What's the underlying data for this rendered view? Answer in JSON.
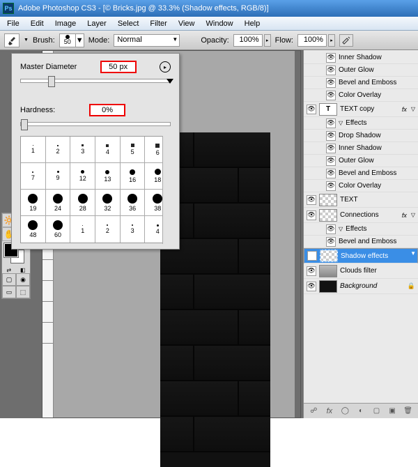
{
  "title": "Adobe Photoshop CS3 - [© Bricks.jpg @ 33.3% (Shadow effects, RGB/8)]",
  "menu": [
    "File",
    "Edit",
    "Image",
    "Layer",
    "Select",
    "Filter",
    "View",
    "Window",
    "Help"
  ],
  "optbar": {
    "brush_label": "Brush:",
    "brush_size": "50",
    "mode_label": "Mode:",
    "mode_value": "Normal",
    "opacity_label": "Opacity:",
    "opacity_value": "100%",
    "flow_label": "Flow:",
    "flow_value": "100%"
  },
  "brush_popup": {
    "diameter_label": "Master Diameter",
    "diameter_value": "50 px",
    "hardness_label": "Hardness:",
    "hardness_value": "0%",
    "presets": [
      [
        "1",
        "2",
        "3",
        "4",
        "5",
        "6"
      ],
      [
        "7",
        "9",
        "12",
        "13",
        "16",
        "18"
      ],
      [
        "19",
        "24",
        "28",
        "32",
        "36",
        "38"
      ],
      [
        "48",
        "60",
        "1",
        "2",
        "3",
        "4"
      ]
    ],
    "sizes": [
      [
        1,
        2,
        3,
        4,
        5,
        6
      ],
      [
        2,
        3,
        5,
        6,
        8,
        9
      ],
      [
        14,
        14,
        14,
        14,
        14,
        14
      ],
      [
        14,
        14,
        1,
        2,
        2,
        3
      ]
    ]
  },
  "layers": {
    "effects_label": "Effects",
    "items": [
      {
        "t": "eff",
        "n": "Inner Shadow"
      },
      {
        "t": "eff",
        "n": "Outer Glow"
      },
      {
        "t": "eff",
        "n": "Bevel and Emboss"
      },
      {
        "t": "eff",
        "n": "Color Overlay"
      },
      {
        "t": "layer",
        "thumb": "T",
        "n": "TEXT copy",
        "fx": true
      },
      {
        "t": "fxh",
        "n": "Effects"
      },
      {
        "t": "eff",
        "n": "Drop Shadow"
      },
      {
        "t": "eff",
        "n": "Inner Shadow"
      },
      {
        "t": "eff",
        "n": "Outer Glow"
      },
      {
        "t": "eff",
        "n": "Bevel and Emboss"
      },
      {
        "t": "eff",
        "n": "Color Overlay"
      },
      {
        "t": "layer",
        "thumb": "chk",
        "n": "TEXT"
      },
      {
        "t": "layer",
        "thumb": "chk",
        "n": "Connections",
        "fx": true
      },
      {
        "t": "fxh",
        "n": "Effects"
      },
      {
        "t": "eff",
        "n": "Bevel and Emboss"
      },
      {
        "t": "layer",
        "thumb": "chk",
        "n": "Shadow effects",
        "sel": true,
        "dotted": true
      },
      {
        "t": "layer",
        "thumb": "cloud",
        "n": "Clouds filter"
      },
      {
        "t": "layer",
        "thumb": "black",
        "n": "Background",
        "ital": true,
        "lock": true
      }
    ]
  }
}
